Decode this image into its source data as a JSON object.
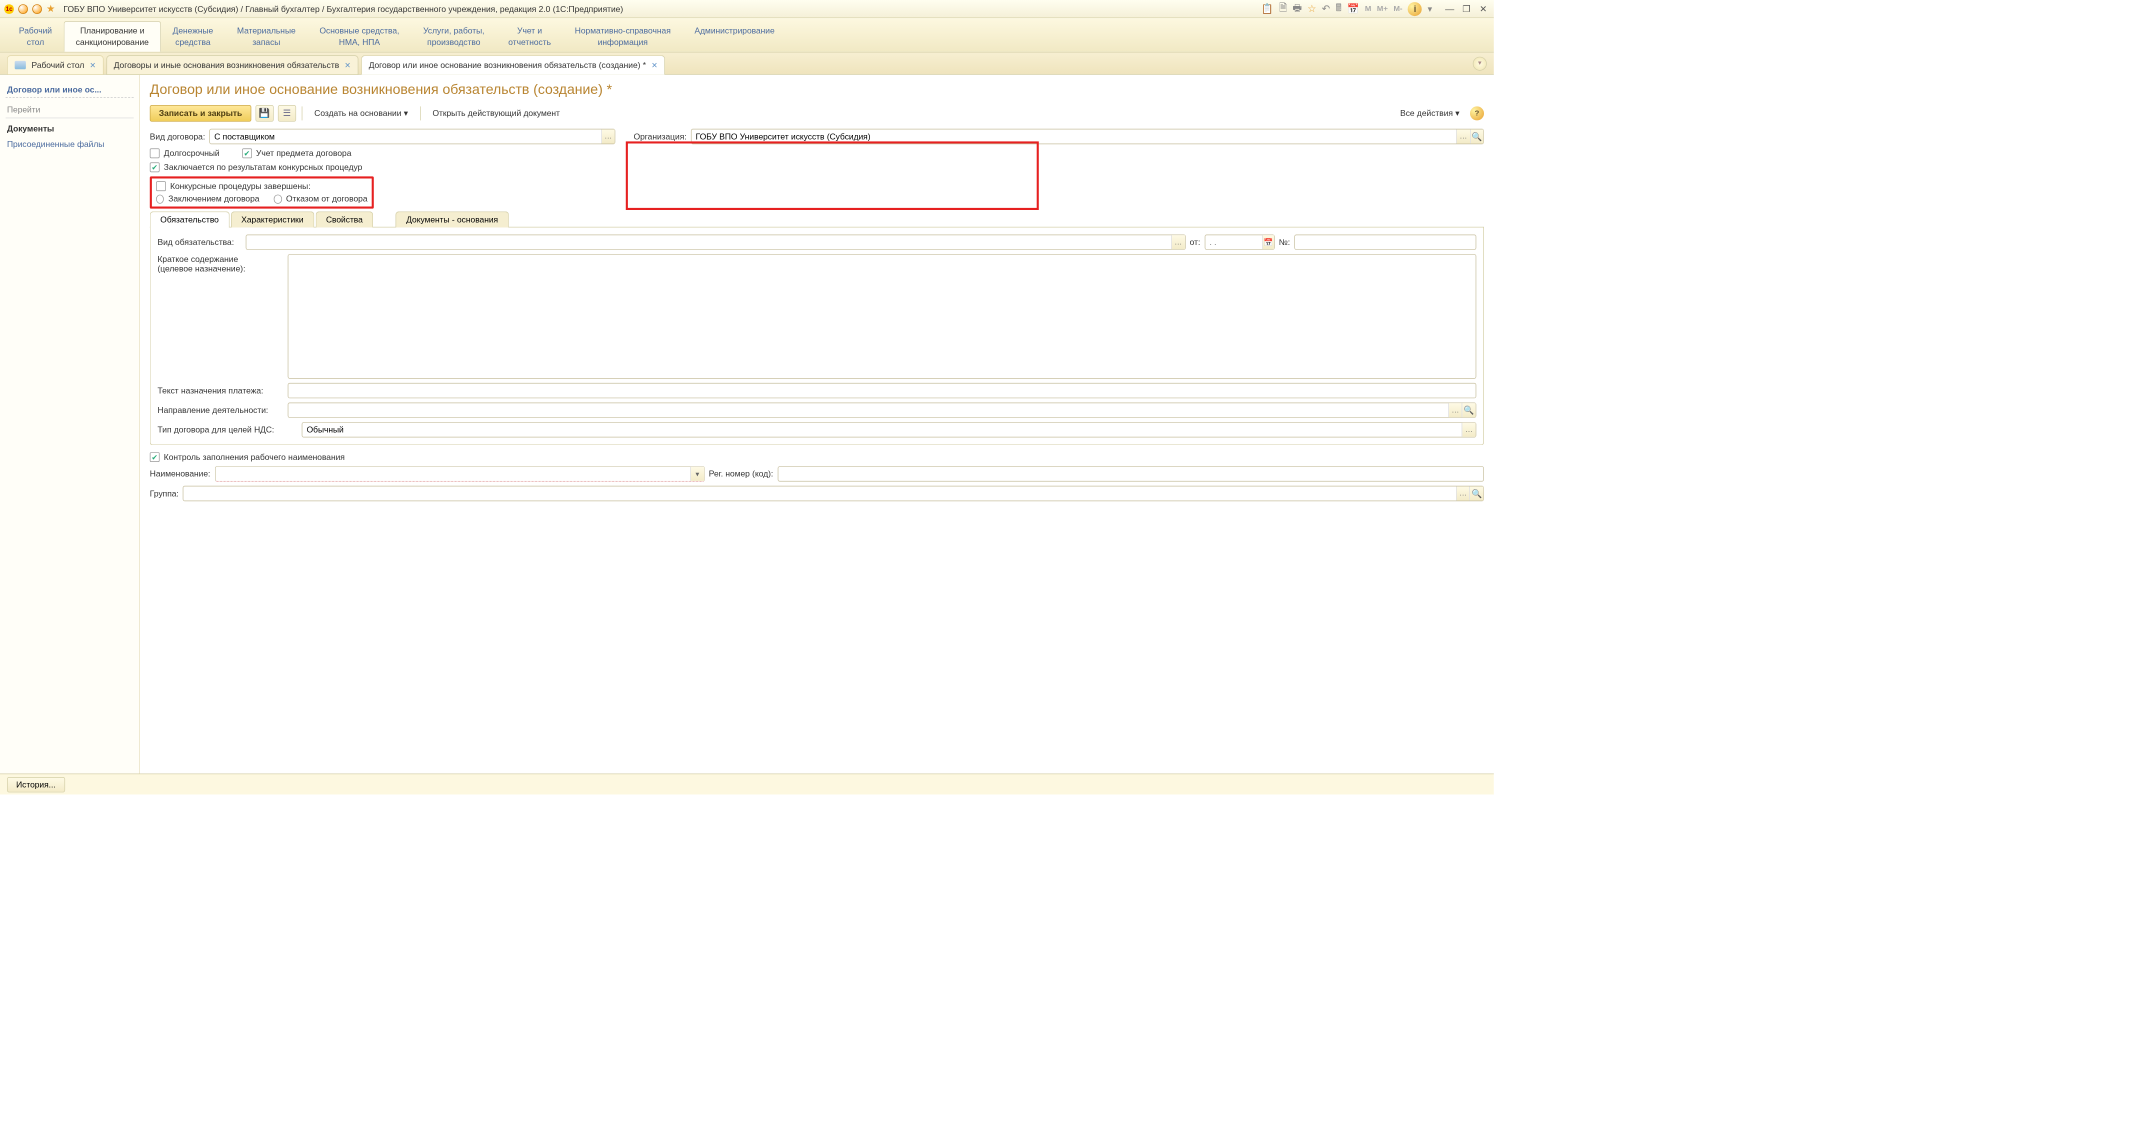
{
  "titlebar": {
    "text": "ГОБУ ВПО Университет искусств (Субсидия) / Главный бухгалтер / Бухгалтерия государственного учреждения, редакция 2.0  (1С:Предприятие)"
  },
  "titlebar_icons": [
    "📋",
    "📄",
    "📑",
    "⭐",
    "↩",
    "🧮",
    "📅",
    "M",
    "M+",
    "M-",
    "ⓘ",
    "▾"
  ],
  "section_tabs": [
    "Рабочий\nстол",
    "Планирование и\nсанкционирование",
    "Денежные\nсредства",
    "Материальные\nзапасы",
    "Основные средства,\nНМА, НПА",
    "Услуги, работы,\nпроизводство",
    "Учет и\nотчетность",
    "Нормативно-справочная\nинформация",
    "Администрирование"
  ],
  "doc_tabs": {
    "home": "Рабочий стол",
    "t1": "Договоры и иные основания возникновения обязательств",
    "t2": "Договор или иное основание возникновения обязательств (создание) *"
  },
  "sidebar": {
    "sec1": "Договор или иное ос...",
    "goto": "Перейти",
    "docs": "Документы",
    "files": "Присоединенные файлы"
  },
  "page": {
    "title": "Договор или иное основание возникновения обязательств (создание) *"
  },
  "toolbar": {
    "save_close": "Записать и закрыть",
    "create_on": "Создать на основании ▾",
    "open_active": "Открыть действующий документ",
    "all_actions": "Все действия ▾"
  },
  "form": {
    "contract_type_label": "Вид договора:",
    "contract_type_value": "С поставщиком",
    "org_label": "Организация:",
    "org_value": "ГОБУ ВПО Университет искусств (Субсидия)",
    "long_term": "Долгосрочный",
    "subject_acc": "Учет предмета договора",
    "by_tender": "Заключается по результатам конкурсных процедур",
    "tender_done": "Конкурсные процедуры завершены:",
    "r1": "Заключением договора",
    "r2": "Отказом от договора"
  },
  "inner_tabs": [
    "Обязательство",
    "Характеристики",
    "Свойства",
    "Документы - основания"
  ],
  "obl": {
    "type_label": "Вид обязательства:",
    "from_label": "от:",
    "date_placeholder": ". .",
    "num_label": "№:",
    "short_label": "Краткое содержание\n(целевое назначение):",
    "payment_text_label": "Текст назначения платежа:",
    "direction_label": "Направление деятельности:",
    "vat_type_label": "Тип договора для целей НДС:",
    "vat_type_value": "Обычный"
  },
  "footer": {
    "ctrl_name": "Контроль заполнения рабочего наименования",
    "name_label": "Наименование:",
    "reg_label": "Рег. номер (код):",
    "group_label": "Группа:"
  },
  "status": {
    "history": "История..."
  }
}
